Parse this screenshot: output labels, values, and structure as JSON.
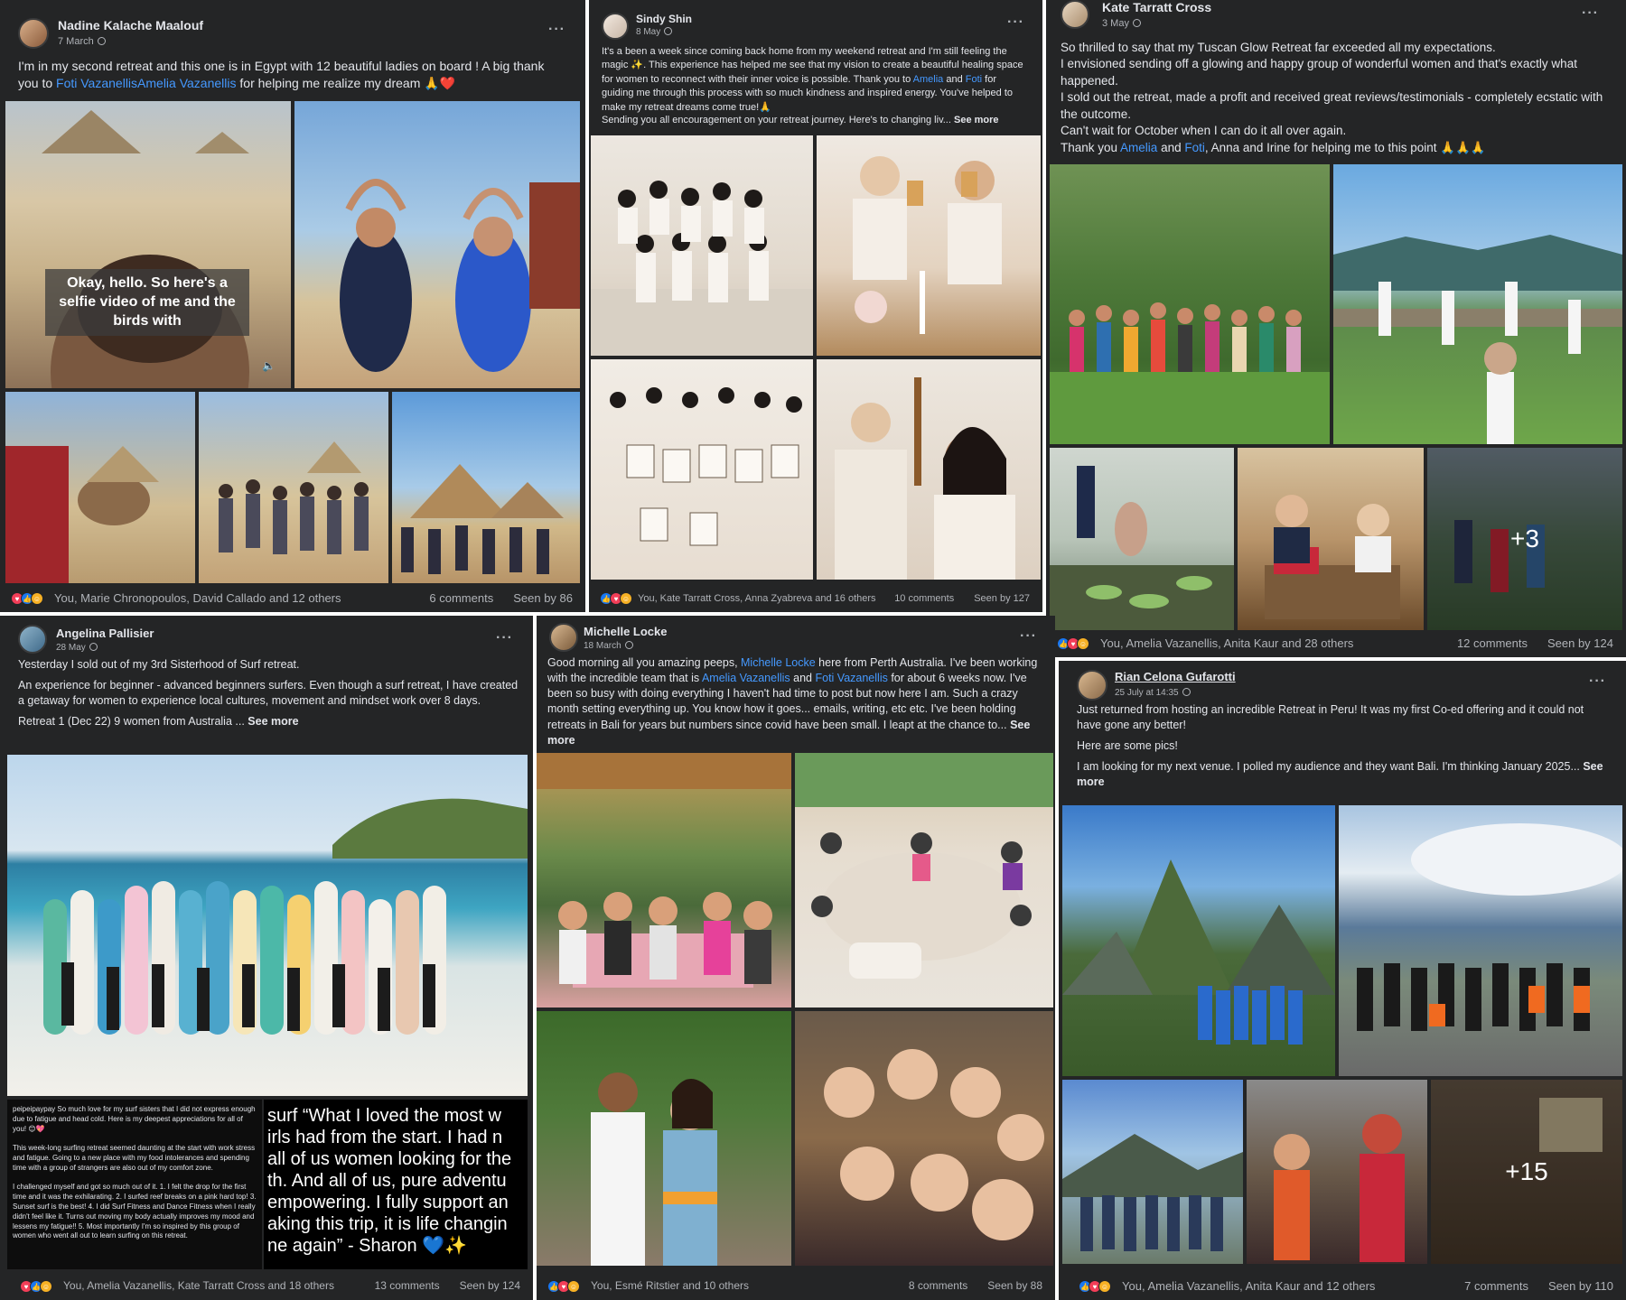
{
  "posts": [
    {
      "author": "Nadine Kalache Maalouf",
      "date": "7 March",
      "text_html": "I'm in my second retreat and this one is in Egypt with 12 beautiful ladies on board ! A big thank you to <span class=\"lnk\">Foti VazanellisAmelia Vazanellis</span> for helping me realize my dream 🙏❤️",
      "video_caption": "Okay, hello. So here's a selfie video of me and the birds with",
      "reactions": "You, Marie Chronopoulos, David Callado and 12 others",
      "comments": "6 comments",
      "seen": "Seen by 86"
    },
    {
      "author": "Sindy Shin",
      "date": "8 May",
      "text_html": "It's a been a week since coming back home from my weekend retreat and I'm still feeling the magic ✨. This experience has helped me see that my vision to create a beautiful healing space for women to reconnect with their inner voice is possible. Thank you to <span class=\"lnk\">Amelia</span> and <span class=\"lnk\">Foti</span> for guiding me through this process with so much kindness and inspired energy. You've helped to make my retreat dreams come true!🙏",
      "text2_html": "Sending you all encouragement on your retreat journey. Here's to changing liv... <span class=\"seemore\">See more</span>",
      "reactions": "You, Kate Tarratt Cross, Anna Zyabreva and 16 others",
      "comments": "10 comments",
      "seen": "Seen by 127"
    },
    {
      "author": "Kate Tarratt Cross",
      "date": "3 May",
      "lines": [
        "So thrilled to say that my Tuscan Glow Retreat far exceeded all my expectations.",
        "I envisioned sending off a glowing and happy group of wonderful women and that's exactly what happened.",
        "I sold out the retreat, made a profit and received great reviews/testimonials - completely ecstatic with the outcome.",
        "Can't wait for October when I can do it all over again."
      ],
      "thanks_html": "Thank you <span class=\"lnk\">Amelia</span> and <span class=\"lnk\">Foti</span>, Anna and Irine for helping me to this point 🙏🙏🙏",
      "more_count": "+3",
      "reactions": "You, Amelia Vazanellis, Anita Kaur and 28 others",
      "comments": "12 comments",
      "seen": "Seen by 124"
    },
    {
      "author": "Angelina Pallisier",
      "date": "28 May",
      "p1": "Yesterday I sold out of my 3rd Sisterhood of Surf retreat.",
      "p2": "An experience for beginner - advanced beginners surfers. Even though a surf retreat, I have created a getaway for women to experience local cultures, movement and mindset work over 8 days.",
      "p3_html": "Retreat 1 (Dec 22) 9 women from Australia ... <span class=\"seemore\">See more</span>",
      "quote_left": "peipeipaypay So much love for my surf sisters that I did not express enough due to fatigue and head cold. Here is my deepest appreciations for all of you! 😊💖\n\nThis week-long surfing retreat seemed daunting at the start with work stress and fatigue. Going to a new place with my food intolerances and spending time with a group of strangers are also out of my comfort zone.\n\nI challenged myself and got so much out of it. 1. I felt the drop for the first time and it was the exhilarating. 2. I surfed reef breaks on a pink hard top! 3. Sunset surf is the best! 4. I did Surf Fitness and Dance Fitness when I really didn't feel like it. Turns out moving my body actually improves my mood and lessens my fatigue!! 5. Most importantly I'm so inspired by this group of women who went all out to learn surfing on this retreat.",
      "quote_right": [
        "surf “What I loved the most w",
        "irls had from the start. I had n",
        "all of us women looking for the",
        "th. And all of us, pure adventu",
        "empowering. I fully support an",
        "aking this trip, it is life changin",
        "ne again” - Sharon 💙✨"
      ],
      "reactions": "You, Amelia Vazanellis, Kate Tarratt Cross and 18 others",
      "comments": "13 comments",
      "seen": "Seen by 124"
    },
    {
      "author": "Michelle Locke",
      "date": "18 March",
      "text_html": "Good morning all you amazing peeps, <span class=\"lnk\">Michelle Locke</span> here from Perth Australia.  I've been working with the incredible team that is <span class=\"lnk\">Amelia Vazanellis</span> and <span class=\"lnk\">Foti Vazanellis</span> for about 6 weeks now. I've been so busy with doing everything I haven't had time to post but now here I am.  Such a crazy month setting everything up. You know how it goes... emails, writing, etc etc. I've been holding retreats in Bali for years but numbers since covid have been small. I leapt at the chance to... <span class=\"seemore\">See more</span>",
      "reactions": "You, Esmé Ritstier and 10 others",
      "comments": "8 comments",
      "seen": "Seen by 88"
    },
    {
      "author": "Rian Celona Gufarotti",
      "date": "25 July at 14:35",
      "p1": "Just returned from hosting an incredible Retreat in Peru! It was my first Co-ed offering and it could not have gone any better!",
      "p2": "Here are some pics!",
      "p3_html": "I am looking for my next venue. I polled my audience and they want Bali. I'm thinking January 2025... <span class=\"seemore\">See more</span>",
      "more_count": "+15",
      "reactions": "You, Amelia Vazanellis, Anita Kaur and 12 others",
      "comments": "7 comments",
      "seen": "Seen by 110"
    }
  ]
}
